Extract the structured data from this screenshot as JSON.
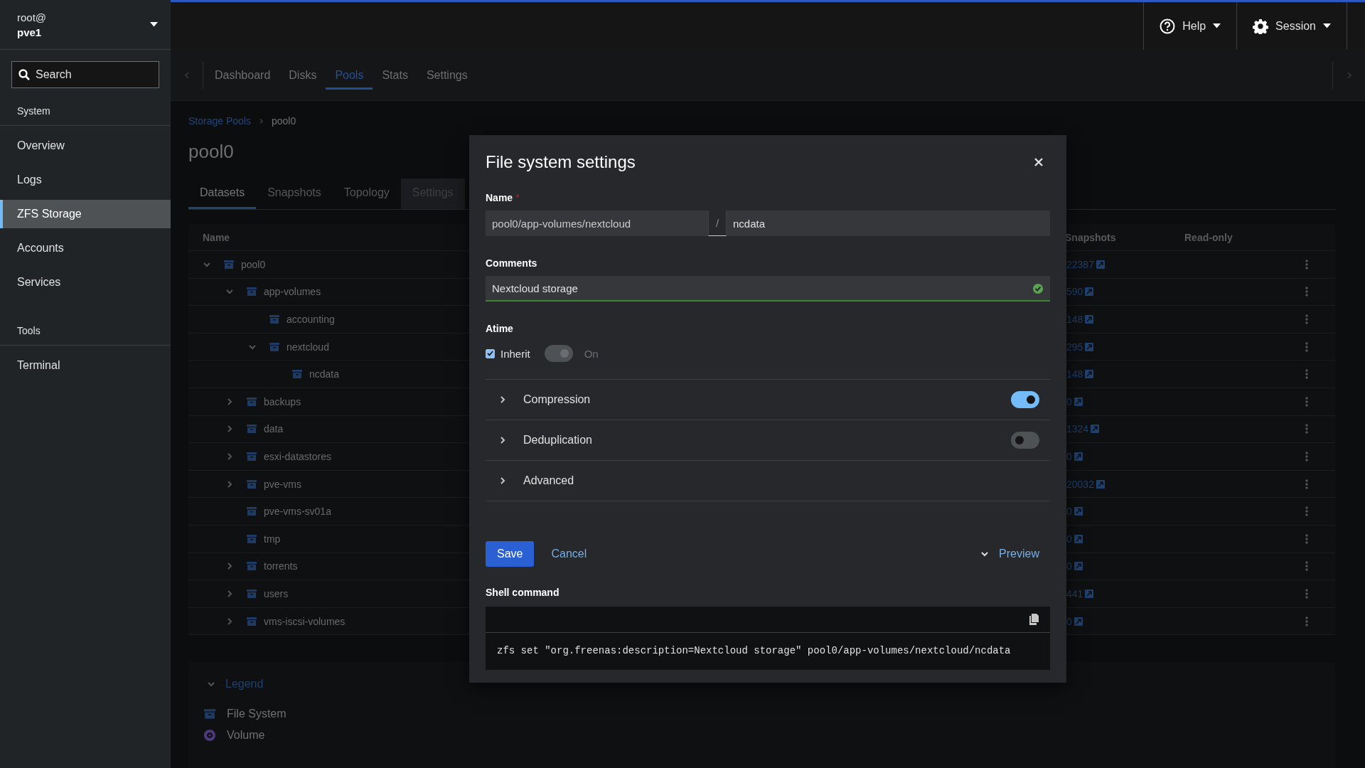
{
  "sidebar": {
    "user": "root@",
    "host": "pve1",
    "search": {
      "placeholder": "Search"
    },
    "sections": [
      {
        "title": "System",
        "items": [
          {
            "label": "Overview",
            "selected": false
          },
          {
            "label": "Logs",
            "selected": false
          },
          {
            "label": "ZFS Storage",
            "selected": true
          },
          {
            "label": "Accounts",
            "selected": false
          },
          {
            "label": "Services",
            "selected": false
          }
        ]
      },
      {
        "title": "Tools",
        "items": [
          {
            "label": "Terminal",
            "selected": false
          }
        ]
      }
    ]
  },
  "topbar": {
    "buttons": [
      {
        "label": "Help",
        "kind": "help"
      },
      {
        "label": "Session",
        "kind": "session"
      }
    ]
  },
  "nav_tabs": [
    {
      "label": "Dashboard",
      "selected": false
    },
    {
      "label": "Disks",
      "selected": false
    },
    {
      "label": "Pools",
      "selected": true
    },
    {
      "label": "Stats",
      "selected": false
    },
    {
      "label": "Settings",
      "selected": false
    }
  ],
  "breadcrumb": [
    "Storage Pools",
    "pool0"
  ],
  "page_title": "pool0",
  "page_tabs": [
    {
      "label": "Datasets",
      "selected": true,
      "disabled": false
    },
    {
      "label": "Snapshots",
      "selected": false,
      "disabled": false
    },
    {
      "label": "Topology",
      "selected": false,
      "disabled": false
    },
    {
      "label": "Settings",
      "selected": false,
      "disabled": true
    }
  ],
  "table": {
    "columns": [
      "Name",
      "Snapshots",
      "Read-only"
    ],
    "rows": [
      {
        "name": "pool0",
        "expanded": true,
        "snapshots": "22387",
        "children": [
          {
            "name": "app-volumes",
            "expanded": true,
            "snapshots": "590",
            "children": [
              {
                "name": "accounting",
                "snapshots": "148"
              },
              {
                "name": "nextcloud",
                "expanded": true,
                "snapshots": "295",
                "children": [
                  {
                    "name": "ncdata",
                    "snapshots": "148"
                  }
                ]
              }
            ]
          },
          {
            "name": "backups",
            "expanded": false,
            "snapshots": "0"
          },
          {
            "name": "data",
            "expanded": false,
            "snapshots": "1324"
          },
          {
            "name": "esxi-datastores",
            "expanded": false,
            "snapshots": "0"
          },
          {
            "name": "pve-vms",
            "expanded": false,
            "snapshots": "20032"
          },
          {
            "name": "pve-vms-sv01a",
            "snapshots": "0"
          },
          {
            "name": "tmp",
            "snapshots": "0"
          },
          {
            "name": "torrents",
            "expanded": false,
            "snapshots": "0"
          },
          {
            "name": "users",
            "expanded": false,
            "snapshots": "441"
          },
          {
            "name": "vms-iscsi-volumes",
            "expanded": false,
            "snapshots": "0"
          }
        ]
      }
    ]
  },
  "legend": {
    "title": "Legend",
    "expanded": true,
    "items": [
      {
        "label": "File System",
        "kind": "filesystem"
      },
      {
        "label": "Volume",
        "kind": "volume"
      }
    ]
  },
  "dialog": {
    "title": "File system settings",
    "name": {
      "label": "Name",
      "required_mark": "*",
      "prefix": "pool0/app-volumes/nextcloud",
      "separator": "/",
      "value": "ncdata"
    },
    "comments": {
      "label": "Comments",
      "value": "Nextcloud storage",
      "valid": true
    },
    "atime": {
      "label": "Atime",
      "inherit": {
        "label": "Inherit",
        "checked": true
      },
      "switch": {
        "on": true,
        "disabled": true
      },
      "state_label": "On"
    },
    "sections": [
      {
        "label": "Compression",
        "expanded": false,
        "switch": {
          "on": true
        }
      },
      {
        "label": "Deduplication",
        "expanded": false,
        "switch": {
          "on": false
        }
      },
      {
        "label": "Advanced",
        "expanded": false
      }
    ],
    "actions": [
      {
        "label": "Save",
        "kind": "primary"
      },
      {
        "label": "Cancel",
        "kind": "link"
      }
    ],
    "preview": {
      "label": "Preview",
      "expanded": true
    },
    "shell": {
      "label": "Shell command",
      "command": "zfs set \"org.freenas:description=Nextcloud storage\" pool0/app-volumes/nextcloud/ncdata"
    }
  }
}
